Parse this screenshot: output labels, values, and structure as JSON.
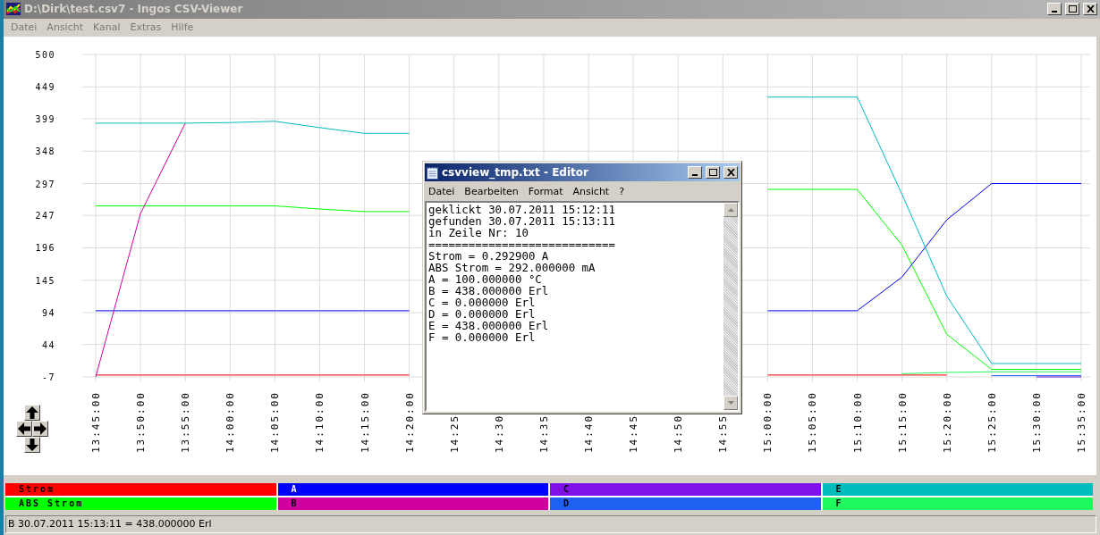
{
  "window": {
    "title": "D:\\Dirk\\test.csv7 - Ingos CSV-Viewer"
  },
  "menu": [
    "Datei",
    "Ansicht",
    "Kanal",
    "Extras",
    "Hilfe"
  ],
  "chart": {
    "chart_data": {
      "type": "line",
      "grid": true,
      "categories": [
        "13:45:00",
        "13:50:00",
        "13:55:00",
        "14:00:00",
        "14:05:00",
        "14:10:00",
        "14:15:00",
        "14:20:00",
        "14:25",
        "14:30",
        "14:35",
        "14:40",
        "14:45",
        "14:50",
        "14:55",
        "15:00:00",
        "15:05:00",
        "15:10:00",
        "15:15:00",
        "15:20:00",
        "15:25:00",
        "15:30:00",
        "15:35:00"
      ],
      "ylim": [
        -7,
        500
      ],
      "yticks": [
        500,
        449,
        399,
        348,
        297,
        247,
        196,
        145,
        94,
        44,
        -7
      ],
      "series": [
        {
          "name": "Strom",
          "color": "#ff0000",
          "values": [
            -4,
            -4,
            -4,
            -4,
            -4,
            -4,
            -4,
            -4,
            null,
            null,
            null,
            null,
            null,
            null,
            null,
            -4,
            -4,
            -4,
            -4,
            -4,
            null,
            null,
            null
          ]
        },
        {
          "name": "ABS Strom",
          "color": "#00ff00",
          "values": [
            262,
            262,
            262,
            262,
            262,
            257,
            253,
            253,
            null,
            null,
            null,
            null,
            null,
            null,
            null,
            288,
            288,
            288,
            200,
            60,
            5,
            5,
            5
          ]
        },
        {
          "name": "A",
          "color": "#0000ff",
          "values": [
            97,
            97,
            97,
            97,
            97,
            97,
            97,
            97,
            null,
            null,
            null,
            null,
            null,
            null,
            null,
            97,
            97,
            97,
            150,
            240,
            297,
            297,
            297
          ]
        },
        {
          "name": "B",
          "color": "#d000a0",
          "values": [
            -7,
            250,
            392,
            null,
            null,
            null,
            null,
            null,
            null,
            null,
            null,
            null,
            null,
            null,
            null,
            null,
            null,
            null,
            null,
            null,
            null,
            null,
            null
          ]
        },
        {
          "name": "C",
          "color": "#8010e8",
          "values": [
            null,
            null,
            null,
            null,
            null,
            null,
            null,
            null,
            null,
            null,
            null,
            null,
            null,
            null,
            null,
            null,
            null,
            null,
            null,
            null,
            null,
            -7,
            -7
          ]
        },
        {
          "name": "D",
          "color": "#2060f0",
          "values": [
            null,
            null,
            null,
            null,
            null,
            null,
            null,
            null,
            null,
            null,
            null,
            null,
            null,
            null,
            null,
            null,
            null,
            null,
            null,
            null,
            -5,
            -5,
            -5
          ]
        },
        {
          "name": "E",
          "color": "#00bcbc",
          "values": [
            392,
            392,
            392,
            393,
            395,
            385,
            376,
            376,
            null,
            null,
            null,
            null,
            null,
            null,
            null,
            433,
            433,
            433,
            280,
            120,
            14,
            14,
            14
          ]
        },
        {
          "name": "F",
          "color": "#20f860",
          "values": [
            null,
            null,
            null,
            null,
            null,
            null,
            null,
            null,
            null,
            null,
            null,
            null,
            null,
            null,
            null,
            null,
            null,
            null,
            -2,
            0,
            1,
            1,
            1
          ]
        }
      ]
    }
  },
  "editor": {
    "title": "csvview_tmp.txt - Editor",
    "menu": [
      "Datei",
      "Bearbeiten",
      "Format",
      "Ansicht",
      "?"
    ],
    "lines": [
      "geklickt 30.07.2011 15:12:11",
      "gefunden 30.07.2011 15:13:11",
      "in Zeile Nr: 10",
      "============================",
      "Strom = 0.292900 A",
      "ABS Strom = 292.000000 mA",
      "A = 100.000000 °C",
      "B = 438.000000 Erl",
      "C = 0.000000 Erl",
      "D = 0.000000 Erl",
      "E = 438.000000 Erl",
      "F = 0.000000 Erl"
    ]
  },
  "status_bar": "B 30.07.2011 15:13:11 = 438.000000 Erl"
}
